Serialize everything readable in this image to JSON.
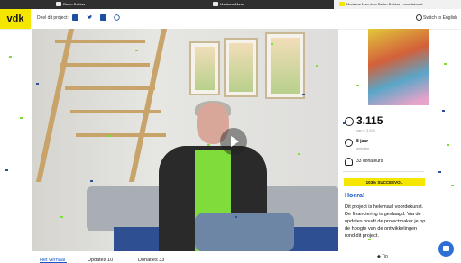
{
  "browser_tabs": [
    {
      "label": "Pedro Bakker"
    },
    {
      "label": "Maderne Maar"
    },
    {
      "label": "Moderne Man door Pedro Bakker - voordekunst"
    }
  ],
  "header": {
    "logo": "vdk",
    "share_label": "Deel dit project:",
    "share_icons": [
      "facebook-icon",
      "twitter-icon",
      "linkedin-icon",
      "whatsapp-icon"
    ],
    "language_switch": "Switch to English"
  },
  "stats": {
    "amount": "3.115",
    "goal": "van € 3.000",
    "duration": "8 jaar",
    "duration_sub": "geleden",
    "donors": "33 donateurs",
    "badge": "103% SUCCESVOL"
  },
  "success_message": {
    "title": "Hoera!",
    "body": "Dit project is helemaal voordekunst. De financiering is geslaagd. Via de updates houdt de projectmaker je op de hoogte van de ontwikkelingen rond dit project."
  },
  "tabs_nav": [
    {
      "label": "Het verhaal"
    },
    {
      "label": "Updates 10"
    },
    {
      "label": "Donaties 33"
    }
  ],
  "tip_label": "Tip",
  "colors": {
    "brand_yellow": "#f5e600",
    "link_blue": "#1a57c6",
    "chat_blue": "#2e6fd6"
  }
}
